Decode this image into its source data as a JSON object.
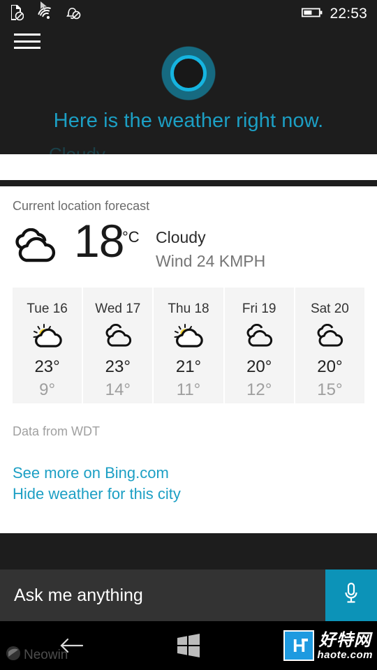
{
  "status_bar": {
    "icons": [
      "sim-blocked-icon",
      "wifi-icon",
      "notifications-off-icon"
    ],
    "battery_icon": "battery-icon",
    "time": "22:53"
  },
  "header": {
    "menu_icon": "hamburger-menu-icon",
    "cortana_icon": "cortana-ring-icon",
    "phrase": "Here is the weather right now.",
    "phrase_secondary": "Cloudy",
    "accent_color": "#1c9fc4"
  },
  "weather": {
    "heading": "Current location forecast",
    "current": {
      "icon": "cloudy-icon",
      "temperature": "18",
      "unit": "°C",
      "condition": "Cloudy",
      "wind": "Wind 24 KMPH"
    },
    "forecast": [
      {
        "day": "Tue 16",
        "icon": "partly-sunny-icon",
        "high": "23°",
        "low": "9°"
      },
      {
        "day": "Wed 17",
        "icon": "cloudy-icon",
        "high": "23°",
        "low": "14°"
      },
      {
        "day": "Thu 18",
        "icon": "partly-sunny-icon",
        "high": "21°",
        "low": "11°"
      },
      {
        "day": "Fri 19",
        "icon": "cloudy-icon",
        "high": "20°",
        "low": "12°"
      },
      {
        "day": "Sat 20",
        "icon": "cloudy-icon",
        "high": "20°",
        "low": "15°"
      }
    ],
    "data_source": "Data from WDT",
    "links": [
      "See more on Bing.com",
      "Hide weather for this city"
    ]
  },
  "ask_bar": {
    "placeholder": "Ask me anything",
    "value": "",
    "mic_icon": "microphone-icon",
    "mic_color": "#0c93b8"
  },
  "nav_bar": {
    "back_icon": "back-arrow-icon",
    "home_icon": "windows-logo-icon"
  },
  "watermarks": {
    "neowin": "Neowin",
    "haote_letter": "H",
    "haote_cn": "好特网",
    "haote_domain": "haote.com"
  }
}
